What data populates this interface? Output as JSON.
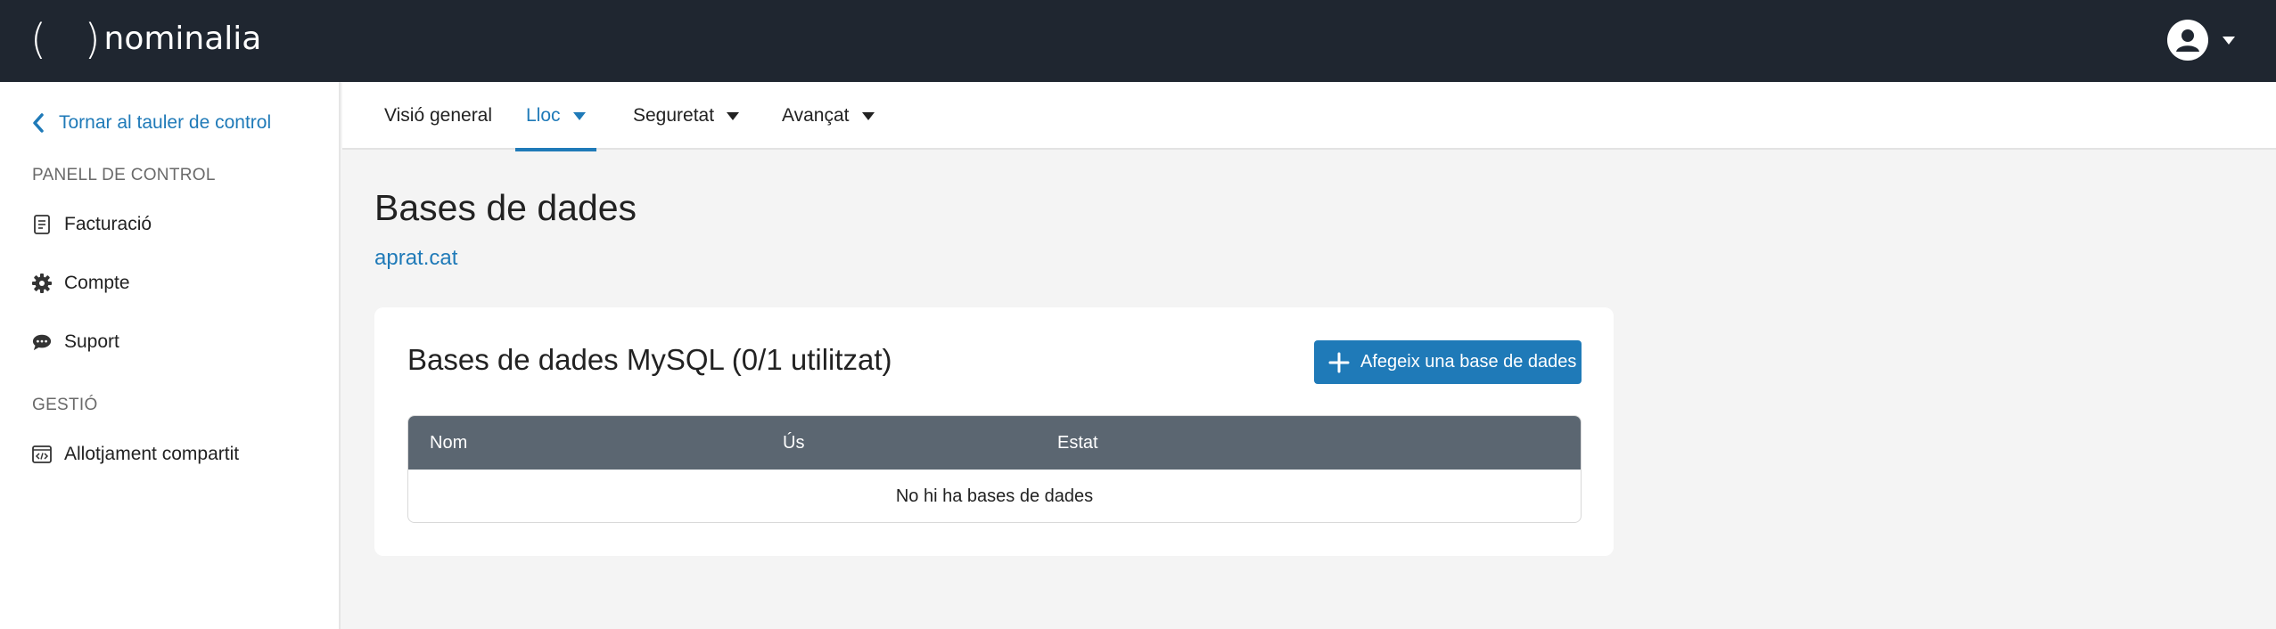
{
  "header": {
    "brand": "nominalia",
    "brand_mark": "( )"
  },
  "sidebar": {
    "back_label": "Tornar al tauler de control",
    "section_panel": "PANELL DE CONTROL",
    "section_manage": "GESTIÓ",
    "items": [
      {
        "label": "Facturació",
        "icon": "invoice-icon"
      },
      {
        "label": "Compte",
        "icon": "gear-icon"
      },
      {
        "label": "Suport",
        "icon": "chat-icon"
      },
      {
        "label": "Allotjament compartit",
        "icon": "code-window-icon"
      }
    ]
  },
  "tabs": [
    {
      "label": "Visió general",
      "dropdown": false,
      "active": false
    },
    {
      "label": "Lloc",
      "dropdown": true,
      "active": true
    },
    {
      "label": "Seguretat",
      "dropdown": true,
      "active": false
    },
    {
      "label": "Avançat",
      "dropdown": true,
      "active": false
    }
  ],
  "main": {
    "title": "Bases de dades",
    "domain": "aprat.cat",
    "card": {
      "title": "Bases de dades MySQL (0/1 utilitzat)",
      "add_button": "Afegeix una base de dades",
      "columns": [
        "Nom",
        "Ús",
        "Estat"
      ],
      "empty_message": "No hi ha bases de dades"
    }
  },
  "colors": {
    "topbar": "#1f2630",
    "accent": "#1f7ab8",
    "table_header": "#5b6671"
  }
}
